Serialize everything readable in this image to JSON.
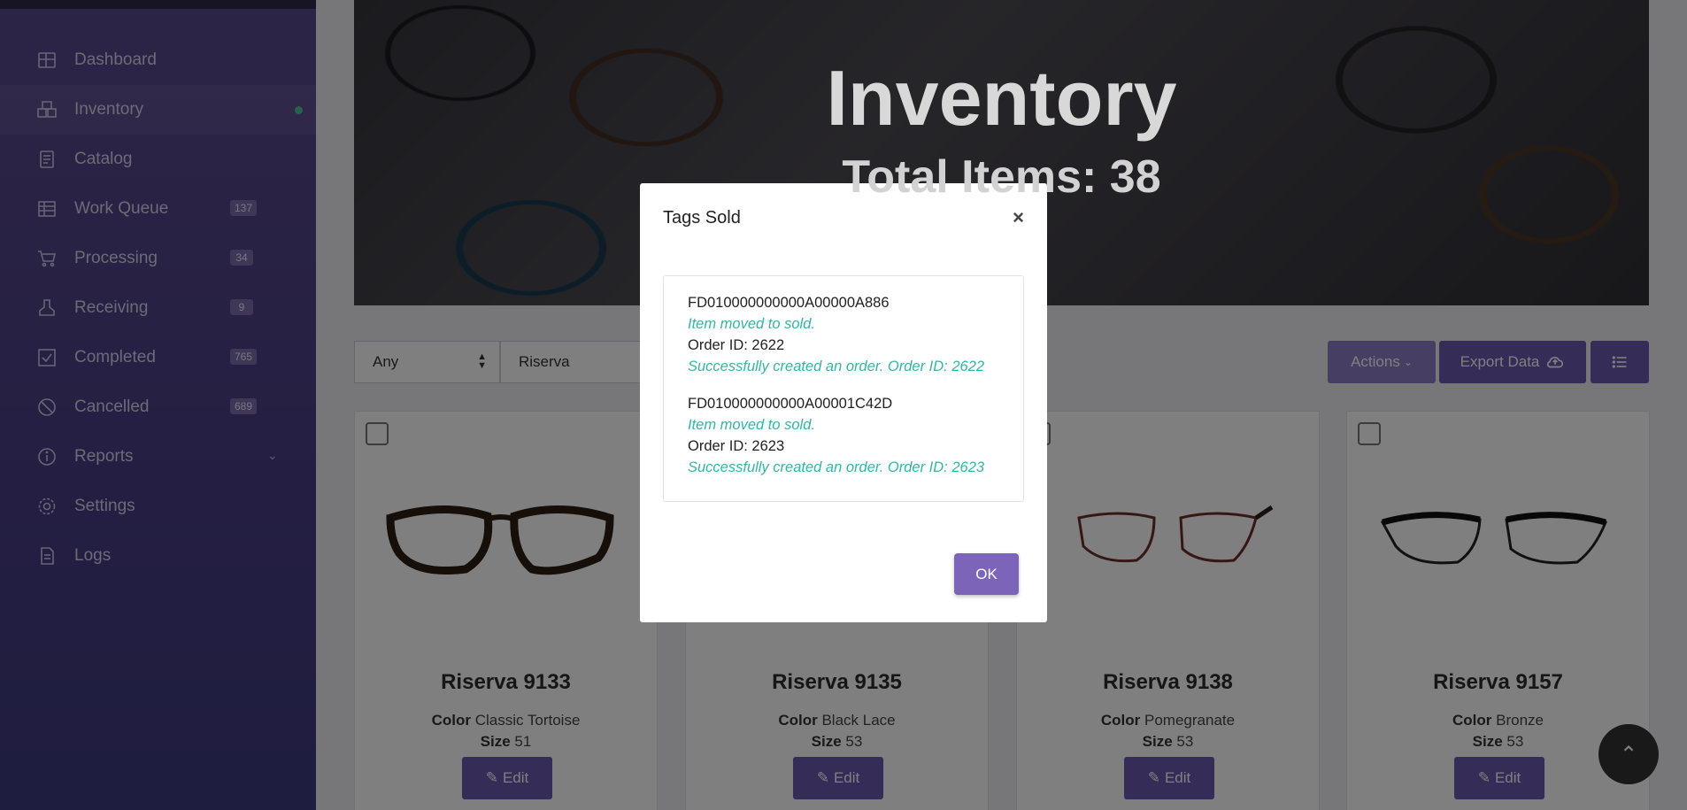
{
  "sidebar": {
    "items": [
      {
        "label": "Dashboard",
        "icon": "dashboard-icon"
      },
      {
        "label": "Inventory",
        "icon": "inventory-icon",
        "active": true
      },
      {
        "label": "Catalog",
        "icon": "catalog-icon"
      },
      {
        "label": "Work Queue",
        "icon": "work-queue-icon",
        "badge": "137"
      },
      {
        "label": "Processing",
        "icon": "cart-icon",
        "badge": "34"
      },
      {
        "label": "Receiving",
        "icon": "receiving-icon",
        "badge": "9"
      },
      {
        "label": "Completed",
        "icon": "check-icon",
        "badge": "765"
      },
      {
        "label": "Cancelled",
        "icon": "cancel-icon",
        "badge": "689"
      },
      {
        "label": "Reports",
        "icon": "info-icon"
      },
      {
        "label": "Settings",
        "icon": "gear-icon"
      },
      {
        "label": "Logs",
        "icon": "document-icon"
      }
    ]
  },
  "hero": {
    "title": "Inventory",
    "subtitle": "Total Items: 38"
  },
  "filters": {
    "select_value": "Any",
    "search_value": "Riserva"
  },
  "toolbar": {
    "actions_label": "Actions",
    "export_label": "Export Data"
  },
  "products": [
    {
      "name": "Riserva 9133",
      "color_label": "Color",
      "color": "Classic Tortoise",
      "size_label": "Size",
      "size": "51",
      "edit_label": "Edit"
    },
    {
      "name": "Riserva 9135",
      "color_label": "Color",
      "color": "Black Lace",
      "size_label": "Size",
      "size": "53",
      "edit_label": "Edit"
    },
    {
      "name": "Riserva 9138",
      "color_label": "Color",
      "color": "Pomegranate",
      "size_label": "Size",
      "size": "53",
      "edit_label": "Edit"
    },
    {
      "name": "Riserva 9157",
      "color_label": "Color",
      "color": "Bronze",
      "size_label": "Size",
      "size": "53",
      "edit_label": "Edit"
    }
  ],
  "modal": {
    "title": "Tags Sold",
    "close": "×",
    "entries": [
      {
        "tag": "FD010000000000A00000A886",
        "moved": "Item moved to sold.",
        "order": "Order ID: 2622",
        "created": "Successfully created an order. Order ID: 2622"
      },
      {
        "tag": "FD010000000000A00001C42D",
        "moved": "Item moved to sold.",
        "order": "Order ID: 2623",
        "created": "Successfully created an order. Order ID: 2623"
      }
    ],
    "ok_label": "OK"
  },
  "colors": {
    "accent": "#6a58b0",
    "success_text": "#35b5a3",
    "sidebar_bg": "#4a3f86"
  }
}
